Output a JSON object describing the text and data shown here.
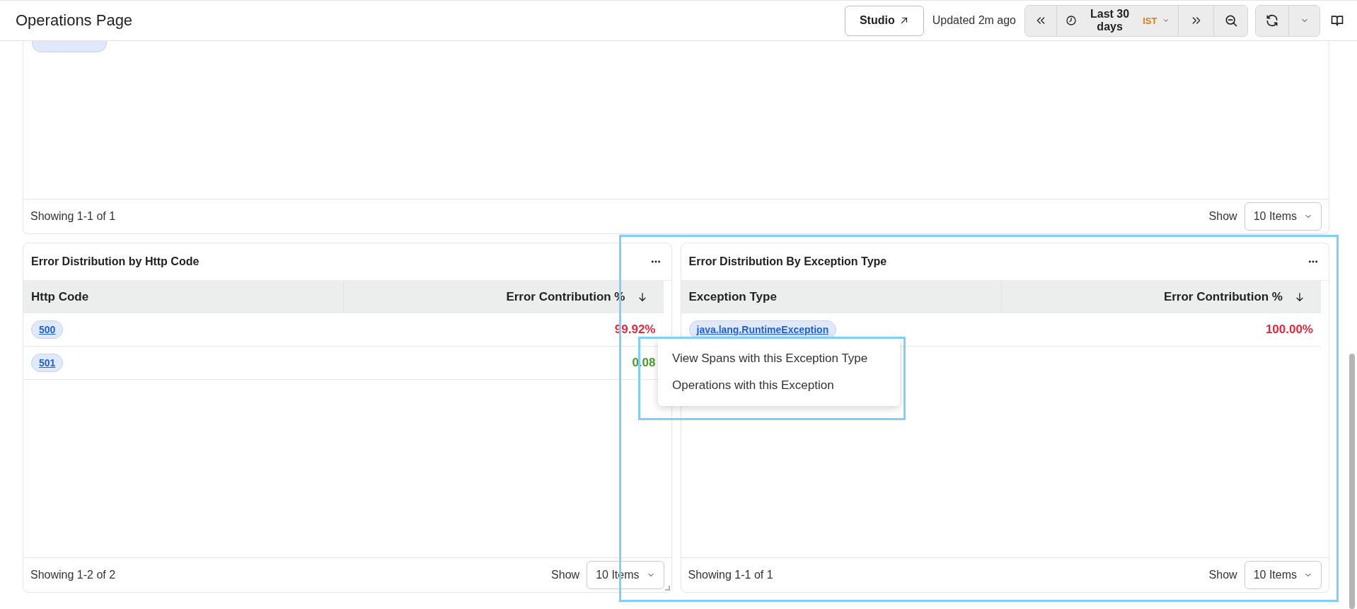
{
  "header": {
    "title": "Operations Page",
    "studio_button": "Studio",
    "updated": "Updated 2m ago",
    "time_range": {
      "label": "Last 30 days",
      "timezone": "IST"
    }
  },
  "top_panel": {
    "footer": {
      "showing": "Showing 1-1 of 1",
      "show_label": "Show",
      "page_size": "10 Items"
    }
  },
  "panels": [
    {
      "title": "Error Distribution by Http Code",
      "columns": [
        {
          "label": "Http Code",
          "sorted": false
        },
        {
          "label": "Error Contribution %",
          "sorted": true
        }
      ],
      "rows": [
        {
          "tag": "500",
          "value": "99.92%",
          "color": "#e0293b"
        },
        {
          "tag": "501",
          "value": "0.08",
          "color": "#4e9a2f"
        }
      ],
      "footer": {
        "showing": "Showing 1-2 of 2",
        "show_label": "Show",
        "page_size": "10 Items"
      }
    },
    {
      "title": "Error Distribution By Exception Type",
      "columns": [
        {
          "label": "Exception Type",
          "sorted": false
        },
        {
          "label": "Error Contribution %",
          "sorted": true
        }
      ],
      "rows": [
        {
          "tag": "java.lang.RuntimeException",
          "value": "100.00%",
          "color": "#e0293b"
        }
      ],
      "footer": {
        "showing": "Showing 1-1 of 1",
        "show_label": "Show",
        "page_size": "10 Items"
      }
    }
  ],
  "context_menu": {
    "items": [
      "View Spans with this Exception Type",
      "Operations with this Exception"
    ]
  }
}
